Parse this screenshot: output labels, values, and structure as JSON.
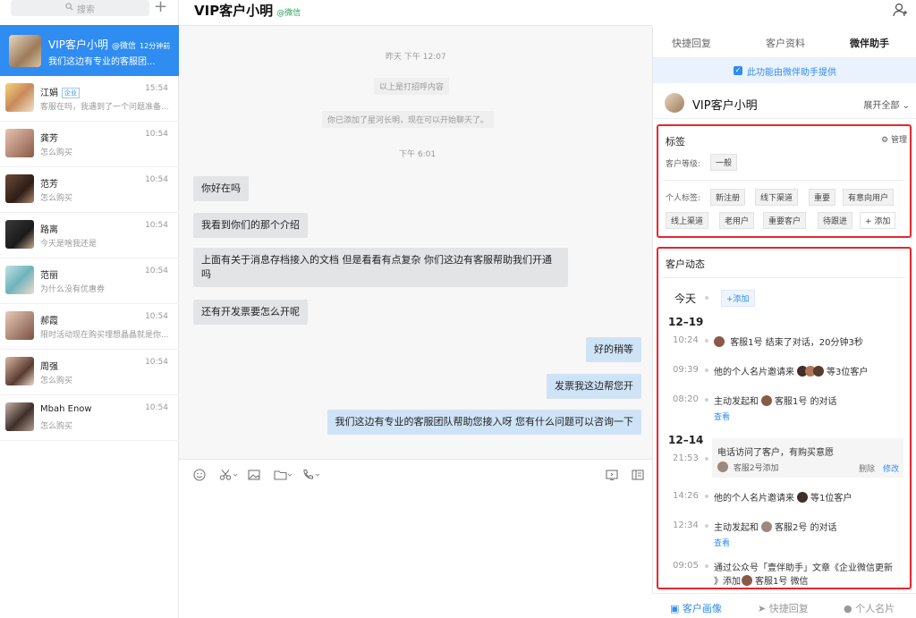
{
  "sidebar": {
    "search_placeholder": "搜索",
    "active": {
      "name": "VIP客户小明",
      "source": "@微信",
      "time": "12分钟前",
      "preview": "我们这边有专业的客服团..."
    },
    "conversations": [
      {
        "name": "江娟",
        "tag": "企业",
        "time": "15:54",
        "preview": "客服在吗，我遇到了一个问题准备..."
      },
      {
        "name": "龚芳",
        "tag": "",
        "time": "10:54",
        "preview": "怎么购买"
      },
      {
        "name": "范芳",
        "tag": "",
        "time": "10:54",
        "preview": "怎么购买"
      },
      {
        "name": "路离",
        "tag": "",
        "time": "10:54",
        "preview": "今天是啥我还是"
      },
      {
        "name": "范丽",
        "tag": "",
        "time": "10:54",
        "preview": "为什么没有优惠券"
      },
      {
        "name": "郝霞",
        "tag": "",
        "time": "10:54",
        "preview": "限时活动现在购买埋想晶晶就是你..."
      },
      {
        "name": "周强",
        "tag": "",
        "time": "10:54",
        "preview": "怎么购买"
      },
      {
        "name": "Mbah Enow",
        "tag": "",
        "time": "10:54",
        "preview": "怎么购买"
      }
    ]
  },
  "header": {
    "title": "VIP客户小明",
    "source": "@微信"
  },
  "chat": {
    "system": {
      "time1": "昨天 下午 12:07",
      "notice1": "以上是打招呼内容",
      "notice2": "你已添加了星河长明，现在可以开始聊天了。",
      "time2": "下午 6:01"
    },
    "left_messages": [
      "你好在吗",
      "我看到你们的那个介绍",
      "上面有关于消息存档接入的文档 但是看看有点复杂 你们这边有客服帮助我们开通吗",
      "还有开发票要怎么开呢"
    ],
    "right_messages": [
      "好的稍等",
      "发票我这边帮您开",
      "我们这边有专业的客服团队帮助您接入呀 您有什么问题可以咨询一下"
    ]
  },
  "right": {
    "tabs": [
      "快捷回复",
      "客户资料",
      "微伴助手"
    ],
    "banner": "此功能由微伴助手提供",
    "profile": {
      "name": "VIP客户小明",
      "expand": "展开全部"
    },
    "tags": {
      "title": "标签",
      "manage": "管理",
      "level_label": "客户等级:",
      "level": "一般",
      "personal_label": "个人标签:",
      "row1": [
        "新注册",
        "线下渠道",
        "重要",
        "有意向用户"
      ],
      "row2": [
        "线上渠道",
        "老用户",
        "重要客户",
        "待跟进",
        "+ 添加"
      ]
    },
    "timeline": {
      "title": "客户动态",
      "today": "今天",
      "add": "+添加",
      "d1": "12–19",
      "e1_time": "10:24",
      "e1_pre": "客服1号",
      "e1_text": "结束了对话，20分钟3秒",
      "e2_time": "09:39",
      "e2_pre": "他的个人名片邀请来",
      "e2_text": "等3位客户",
      "e3_time": "08:20",
      "e3_pre": "主动发起和",
      "e3_agent": "客服1号",
      "e3_text": "的对话",
      "e3_link": "查看",
      "d2": "12–14",
      "e4_time": "21:53",
      "e4_note": "电话访问了客户，有购买意愿",
      "e4_by": "客服2号添加",
      "e4_del": "删除",
      "e4_edit": "修改",
      "e5_time": "14:26",
      "e5_pre": "他的个人名片邀请来",
      "e5_text": "等1位客户",
      "e6_time": "12:34",
      "e6_pre": "主动发起和",
      "e6_agent": "客服2号",
      "e6_text": "的对话",
      "e6_link": "查看",
      "e7_time": "09:05",
      "e7_line1": "通过公众号「壹伴助手」文章《企业微信更新",
      "e7_line2_pre": "》添加",
      "e7_line2_agent": "客服1号",
      "e7_line2_post": "微信"
    },
    "bottom": [
      "客户画像",
      "快捷回复",
      "个人名片"
    ]
  },
  "colors": {
    "accent": "#2f8cf0",
    "highlight": "#e8262c"
  }
}
